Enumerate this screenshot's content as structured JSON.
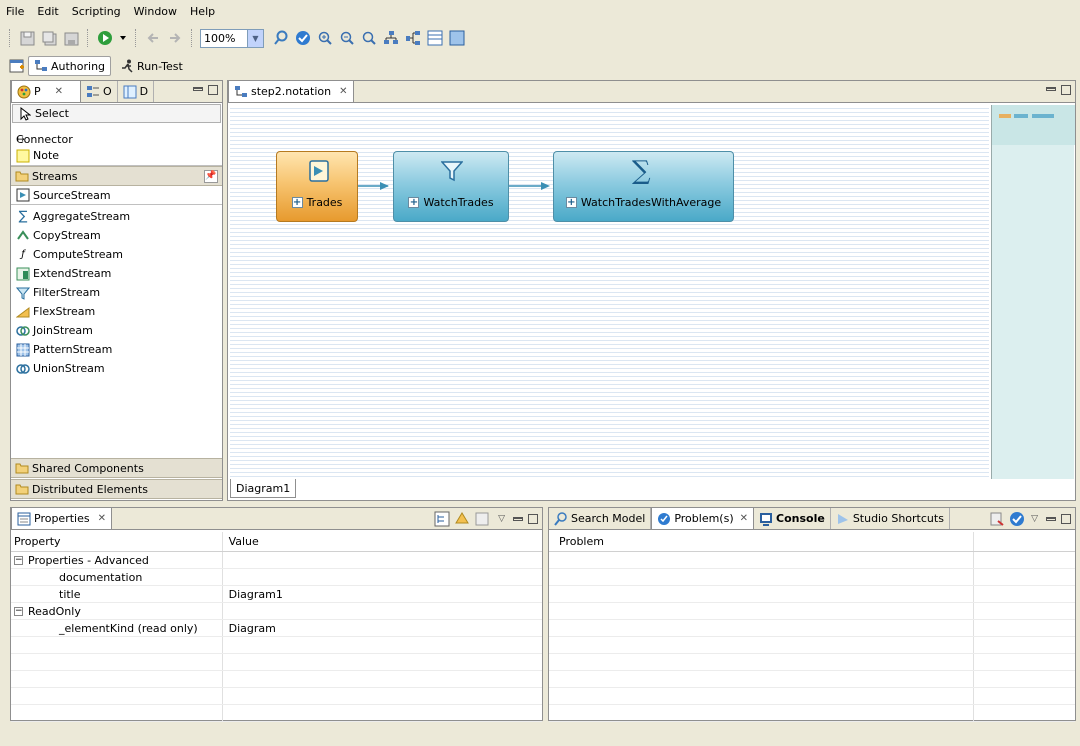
{
  "menu": [
    "File",
    "Edit",
    "Scripting",
    "Window",
    "Help"
  ],
  "toolbar": {
    "zoom": "100%"
  },
  "perspectives": {
    "authoring": "Authoring",
    "run_test": "Run-Test"
  },
  "palette": {
    "tabs": [
      "P",
      "O",
      "D"
    ],
    "top_items": [
      "Select",
      "Connector",
      "Note"
    ],
    "streams_drawer": "Streams",
    "source_item": "SourceStream",
    "stream_items": [
      "AggregateStream",
      "CopyStream",
      "ComputeStream",
      "ExtendStream",
      "FilterStream",
      "FlexStream",
      "JoinStream",
      "PatternStream",
      "UnionStream"
    ],
    "shared_drawer": "Shared Components",
    "distributed_drawer": "Distributed Elements"
  },
  "editor": {
    "tab_title": "step2.notation",
    "diagram_tab": "Diagram1",
    "nodes": [
      "Trades",
      "WatchTrades",
      "WatchTradesWithAverage"
    ]
  },
  "properties": {
    "tab_title": "Properties",
    "col_property": "Property",
    "col_value": "Value",
    "rows": [
      {
        "name": "Properties - Advanced",
        "value": "",
        "group": true
      },
      {
        "name": "documentation",
        "value": "",
        "group": false
      },
      {
        "name": "title",
        "value": "Diagram1",
        "group": false
      },
      {
        "name": "ReadOnly",
        "value": "",
        "group": true
      },
      {
        "name": "_elementKind (read only)",
        "value": "Diagram",
        "group": false
      }
    ]
  },
  "bottom_right": {
    "tabs": [
      "Search Model",
      "Problem(s)",
      "Console",
      "Studio Shortcuts"
    ],
    "col_problem": "Problem"
  },
  "colors": {
    "node_teal": "#4aa9c8",
    "node_orange": "#e79a2e",
    "connector": "#3a8fb5"
  }
}
